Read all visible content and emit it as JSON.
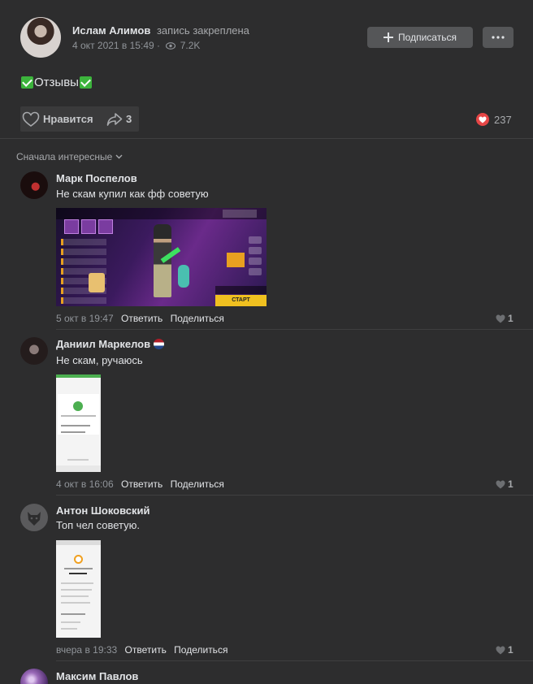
{
  "post": {
    "author": "Ислам Алимов",
    "pinned_note": "запись закреплена",
    "date": "4 окт 2021 в 15:49 ·",
    "views": "7.2K",
    "subscribe_label": "Подписаться",
    "text": "Отзывы",
    "like_label": "Нравится",
    "share_count": "3",
    "likes_total": "237"
  },
  "comments_sort": "Сначала интересные",
  "comments": [
    {
      "author": "Марк Поспелов",
      "text": "Не скам купил как фф советую",
      "time": "5 окт в 19:47",
      "reply": "Ответить",
      "share": "Поделиться",
      "likes": "1",
      "image_start_label": "СТАРТ"
    },
    {
      "author": "Даниил Маркелов",
      "text": "Не скам, ручаюсь",
      "time": "4 окт в 16:06",
      "reply": "Ответить",
      "share": "Поделиться",
      "likes": "1"
    },
    {
      "author": "Антон Шоковский",
      "text": "Топ чел советую.",
      "time": "вчера в 19:33",
      "reply": "Ответить",
      "share": "Поделиться",
      "likes": "1"
    },
    {
      "author": "Максим Павлов"
    }
  ],
  "colors": {
    "background": "#2d2d2e",
    "button": "#555658",
    "like_badge": "#e64646",
    "check_green": "#3cb43c"
  },
  "icons": [
    "eye-icon",
    "plus-icon",
    "more-icon",
    "heart-outline-icon",
    "share-icon",
    "heart-filled-icon",
    "chevron-down-icon",
    "check-emoji-icon",
    "flag-icon"
  ]
}
